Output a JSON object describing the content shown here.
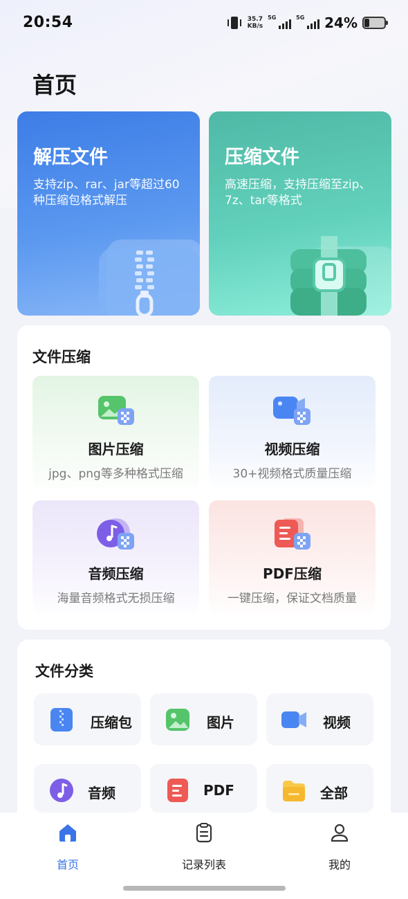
{
  "status_bar": {
    "time": "20:54",
    "net_speed_value": "35.7",
    "net_speed_unit": "KB/s",
    "sim1_label": "5G",
    "sim2_label": "5G",
    "battery_percent": "24%",
    "icons": [
      "vibrate-icon",
      "signal-icon",
      "battery-icon"
    ]
  },
  "page": {
    "title": "首页"
  },
  "hero_cards": [
    {
      "title": "解压文件",
      "desc": "支持zip、rar、jar等超过60种压缩包格式解压",
      "icon": "zipper-folder-icon",
      "color": "#3d7de6"
    },
    {
      "title": "压缩文件",
      "desc": "高速压缩，支持压缩至zip、7z、tar等格式",
      "icon": "archive-box-icon",
      "color": "#4fb9a6"
    }
  ],
  "compress_section": {
    "title": "文件压缩",
    "items": [
      {
        "title": "图片压缩",
        "desc": "jpg、png等多种格式压缩",
        "icon": "image-compress-icon",
        "color": "#4cbf62"
      },
      {
        "title": "视频压缩",
        "desc": "30+视频格式质量压缩",
        "icon": "video-compress-icon",
        "color": "#3f7ff0"
      },
      {
        "title": "音频压缩",
        "desc": "海量音频格式无损压缩",
        "icon": "audio-compress-icon",
        "color": "#7e5fe6"
      },
      {
        "title": "PDF压缩",
        "desc": "一键压缩，保证文档质量",
        "icon": "pdf-compress-icon",
        "color": "#ee5a55"
      }
    ]
  },
  "category_section": {
    "title": "文件分类",
    "items": [
      {
        "label": "压缩包",
        "icon": "zip-icon",
        "color": "#3f7ff0"
      },
      {
        "label": "图片",
        "icon": "image-icon",
        "color": "#4cbf62"
      },
      {
        "label": "视频",
        "icon": "video-icon",
        "color": "#3f7ff0"
      },
      {
        "label": "音频",
        "icon": "audio-icon",
        "color": "#7e5fe6"
      },
      {
        "label": "PDF",
        "icon": "pdf-icon",
        "color": "#ee5a55"
      },
      {
        "label": "全部",
        "icon": "folder-icon",
        "color": "#f6b82e"
      }
    ]
  },
  "tab_bar": {
    "active": "首页",
    "tabs": [
      {
        "label": "首页",
        "icon": "home-icon"
      },
      {
        "label": "记录列表",
        "icon": "clipboard-icon"
      },
      {
        "label": "我的",
        "icon": "user-icon"
      }
    ]
  },
  "theme": {
    "accent": "#3a74e8"
  }
}
